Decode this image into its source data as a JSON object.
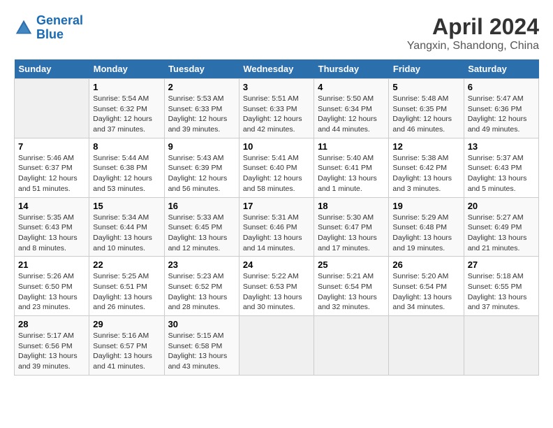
{
  "logo": {
    "line1": "General",
    "line2": "Blue"
  },
  "title": "April 2024",
  "subtitle": "Yangxin, Shandong, China",
  "days_of_week": [
    "Sunday",
    "Monday",
    "Tuesday",
    "Wednesday",
    "Thursday",
    "Friday",
    "Saturday"
  ],
  "weeks": [
    [
      {
        "num": "",
        "sunrise": "",
        "sunset": "",
        "daylight": "",
        "empty": true
      },
      {
        "num": "1",
        "sunrise": "Sunrise: 5:54 AM",
        "sunset": "Sunset: 6:32 PM",
        "daylight": "Daylight: 12 hours and 37 minutes."
      },
      {
        "num": "2",
        "sunrise": "Sunrise: 5:53 AM",
        "sunset": "Sunset: 6:33 PM",
        "daylight": "Daylight: 12 hours and 39 minutes."
      },
      {
        "num": "3",
        "sunrise": "Sunrise: 5:51 AM",
        "sunset": "Sunset: 6:33 PM",
        "daylight": "Daylight: 12 hours and 42 minutes."
      },
      {
        "num": "4",
        "sunrise": "Sunrise: 5:50 AM",
        "sunset": "Sunset: 6:34 PM",
        "daylight": "Daylight: 12 hours and 44 minutes."
      },
      {
        "num": "5",
        "sunrise": "Sunrise: 5:48 AM",
        "sunset": "Sunset: 6:35 PM",
        "daylight": "Daylight: 12 hours and 46 minutes."
      },
      {
        "num": "6",
        "sunrise": "Sunrise: 5:47 AM",
        "sunset": "Sunset: 6:36 PM",
        "daylight": "Daylight: 12 hours and 49 minutes."
      }
    ],
    [
      {
        "num": "7",
        "sunrise": "Sunrise: 5:46 AM",
        "sunset": "Sunset: 6:37 PM",
        "daylight": "Daylight: 12 hours and 51 minutes."
      },
      {
        "num": "8",
        "sunrise": "Sunrise: 5:44 AM",
        "sunset": "Sunset: 6:38 PM",
        "daylight": "Daylight: 12 hours and 53 minutes."
      },
      {
        "num": "9",
        "sunrise": "Sunrise: 5:43 AM",
        "sunset": "Sunset: 6:39 PM",
        "daylight": "Daylight: 12 hours and 56 minutes."
      },
      {
        "num": "10",
        "sunrise": "Sunrise: 5:41 AM",
        "sunset": "Sunset: 6:40 PM",
        "daylight": "Daylight: 12 hours and 58 minutes."
      },
      {
        "num": "11",
        "sunrise": "Sunrise: 5:40 AM",
        "sunset": "Sunset: 6:41 PM",
        "daylight": "Daylight: 13 hours and 1 minute."
      },
      {
        "num": "12",
        "sunrise": "Sunrise: 5:38 AM",
        "sunset": "Sunset: 6:42 PM",
        "daylight": "Daylight: 13 hours and 3 minutes."
      },
      {
        "num": "13",
        "sunrise": "Sunrise: 5:37 AM",
        "sunset": "Sunset: 6:43 PM",
        "daylight": "Daylight: 13 hours and 5 minutes."
      }
    ],
    [
      {
        "num": "14",
        "sunrise": "Sunrise: 5:35 AM",
        "sunset": "Sunset: 6:43 PM",
        "daylight": "Daylight: 13 hours and 8 minutes."
      },
      {
        "num": "15",
        "sunrise": "Sunrise: 5:34 AM",
        "sunset": "Sunset: 6:44 PM",
        "daylight": "Daylight: 13 hours and 10 minutes."
      },
      {
        "num": "16",
        "sunrise": "Sunrise: 5:33 AM",
        "sunset": "Sunset: 6:45 PM",
        "daylight": "Daylight: 13 hours and 12 minutes."
      },
      {
        "num": "17",
        "sunrise": "Sunrise: 5:31 AM",
        "sunset": "Sunset: 6:46 PM",
        "daylight": "Daylight: 13 hours and 14 minutes."
      },
      {
        "num": "18",
        "sunrise": "Sunrise: 5:30 AM",
        "sunset": "Sunset: 6:47 PM",
        "daylight": "Daylight: 13 hours and 17 minutes."
      },
      {
        "num": "19",
        "sunrise": "Sunrise: 5:29 AM",
        "sunset": "Sunset: 6:48 PM",
        "daylight": "Daylight: 13 hours and 19 minutes."
      },
      {
        "num": "20",
        "sunrise": "Sunrise: 5:27 AM",
        "sunset": "Sunset: 6:49 PM",
        "daylight": "Daylight: 13 hours and 21 minutes."
      }
    ],
    [
      {
        "num": "21",
        "sunrise": "Sunrise: 5:26 AM",
        "sunset": "Sunset: 6:50 PM",
        "daylight": "Daylight: 13 hours and 23 minutes."
      },
      {
        "num": "22",
        "sunrise": "Sunrise: 5:25 AM",
        "sunset": "Sunset: 6:51 PM",
        "daylight": "Daylight: 13 hours and 26 minutes."
      },
      {
        "num": "23",
        "sunrise": "Sunrise: 5:23 AM",
        "sunset": "Sunset: 6:52 PM",
        "daylight": "Daylight: 13 hours and 28 minutes."
      },
      {
        "num": "24",
        "sunrise": "Sunrise: 5:22 AM",
        "sunset": "Sunset: 6:53 PM",
        "daylight": "Daylight: 13 hours and 30 minutes."
      },
      {
        "num": "25",
        "sunrise": "Sunrise: 5:21 AM",
        "sunset": "Sunset: 6:54 PM",
        "daylight": "Daylight: 13 hours and 32 minutes."
      },
      {
        "num": "26",
        "sunrise": "Sunrise: 5:20 AM",
        "sunset": "Sunset: 6:54 PM",
        "daylight": "Daylight: 13 hours and 34 minutes."
      },
      {
        "num": "27",
        "sunrise": "Sunrise: 5:18 AM",
        "sunset": "Sunset: 6:55 PM",
        "daylight": "Daylight: 13 hours and 37 minutes."
      }
    ],
    [
      {
        "num": "28",
        "sunrise": "Sunrise: 5:17 AM",
        "sunset": "Sunset: 6:56 PM",
        "daylight": "Daylight: 13 hours and 39 minutes."
      },
      {
        "num": "29",
        "sunrise": "Sunrise: 5:16 AM",
        "sunset": "Sunset: 6:57 PM",
        "daylight": "Daylight: 13 hours and 41 minutes."
      },
      {
        "num": "30",
        "sunrise": "Sunrise: 5:15 AM",
        "sunset": "Sunset: 6:58 PM",
        "daylight": "Daylight: 13 hours and 43 minutes."
      },
      {
        "num": "",
        "sunrise": "",
        "sunset": "",
        "daylight": "",
        "empty": true
      },
      {
        "num": "",
        "sunrise": "",
        "sunset": "",
        "daylight": "",
        "empty": true
      },
      {
        "num": "",
        "sunrise": "",
        "sunset": "",
        "daylight": "",
        "empty": true
      },
      {
        "num": "",
        "sunrise": "",
        "sunset": "",
        "daylight": "",
        "empty": true
      }
    ]
  ]
}
